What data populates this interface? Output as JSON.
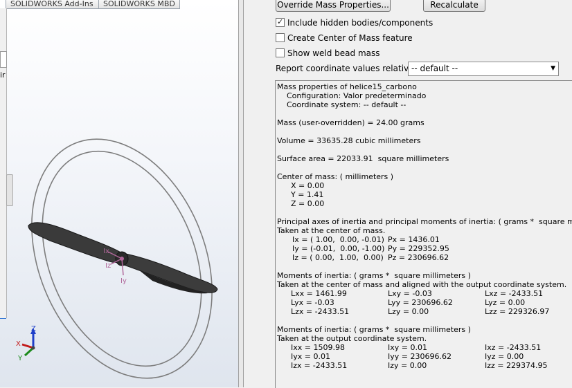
{
  "tabs": [
    "SOLIDWORKS Add-Ins",
    "SOLIDWORKS MBD"
  ],
  "left_strip_text": "ir",
  "triad": {
    "x": "X",
    "y": "Y",
    "z": "Z"
  },
  "axis_labels": {
    "ix": "Ix",
    "iy": "Iy",
    "iz": "Iz"
  },
  "buttons": {
    "override": "Override Mass Properties...",
    "recalculate": "Recalculate"
  },
  "options": [
    {
      "label": "Include hidden bodies/components",
      "checked": true
    },
    {
      "label": "Create Center of Mass feature",
      "checked": false
    },
    {
      "label": "Show weld bead mass",
      "checked": false
    }
  ],
  "report": {
    "label": "Report coordinate values relative to:",
    "value": "-- default --"
  },
  "results": {
    "header": "Mass properties of helice15_carbono",
    "configuration": "Configuration: Valor predeterminado",
    "coord_system": "Coordinate system: -- default --",
    "mass": "Mass (user-overridden) = 24.00 grams",
    "volume": "Volume = 33635.28 cubic millimeters",
    "surface": "Surface area = 22033.91  square millimeters",
    "com_title": "Center of mass: ( millimeters )",
    "com_x": "X = 0.00",
    "com_y": "Y = 1.41",
    "com_z": "Z = 0.00",
    "principal_title": "Principal axes of inertia and principal moments of inertia: ( grams *  square millimeters )",
    "principal_sub": "Taken at the center of mass.",
    "principal_rows": [
      [
        "Ix = ( 1.00,  0.00, -0.01)",
        "Px = 1436.01"
      ],
      [
        "Iy = (-0.01,  0.00, -1.00)",
        "Py = 229352.95"
      ],
      [
        "Iz = ( 0.00,  1.00,  0.00)",
        "Pz = 230696.62"
      ]
    ],
    "moments_com_title": "Moments of inertia: ( grams *  square millimeters )",
    "moments_com_sub": "Taken at the center of mass and aligned with the output coordinate system.",
    "moments_com_rows": [
      [
        "Lxx = 1461.99",
        "Lxy = -0.03",
        "Lxz = -2433.51"
      ],
      [
        "Lyx = -0.03",
        "Lyy = 230696.62",
        "Lyz = 0.00"
      ],
      [
        "Lzx = -2433.51",
        "Lzy = 0.00",
        "Lzz = 229326.97"
      ]
    ],
    "moments_out_title": "Moments of inertia: ( grams *  square millimeters )",
    "moments_out_sub": "Taken at the output coordinate system.",
    "moments_out_rows": [
      [
        "Ixx = 1509.98",
        "Ixy = 0.01",
        "Ixz = -2433.51"
      ],
      [
        "Iyx = 0.01",
        "Iyy = 230696.62",
        "Iyz = 0.00"
      ],
      [
        "Izx = -2433.51",
        "Izy = 0.00",
        "Izz = 229374.95"
      ]
    ]
  }
}
